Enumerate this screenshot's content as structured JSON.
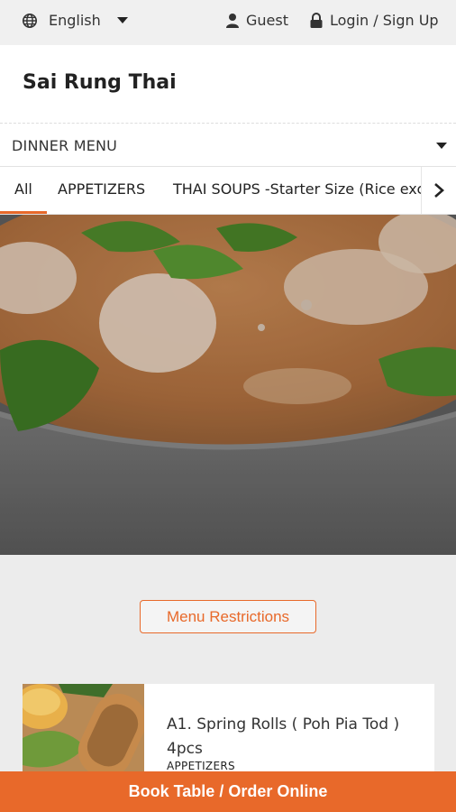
{
  "topbar": {
    "language": "English",
    "guest": "Guest",
    "login": "Login / Sign Up"
  },
  "restaurant": {
    "name": "Sai Rung Thai"
  },
  "menu_select": {
    "value": "DINNER MENU"
  },
  "tabs": [
    {
      "label": "All"
    },
    {
      "label": "APPETIZERS"
    },
    {
      "label": "THAI SOUPS -Starter Size (Rice exclu"
    }
  ],
  "restrictions": {
    "label": "Menu Restrictions"
  },
  "items": [
    {
      "title": "A1. Spring Rolls ( Poh Pia Tod ) 4pcs",
      "category": "APPETIZERS"
    }
  ],
  "cta": {
    "label": "Book Table / Order Online"
  },
  "colors": {
    "accent": "#e8692a"
  },
  "icons": [
    "globe-icon",
    "user-icon",
    "lock-icon",
    "chevron-right-icon",
    "caret-down-icon"
  ]
}
